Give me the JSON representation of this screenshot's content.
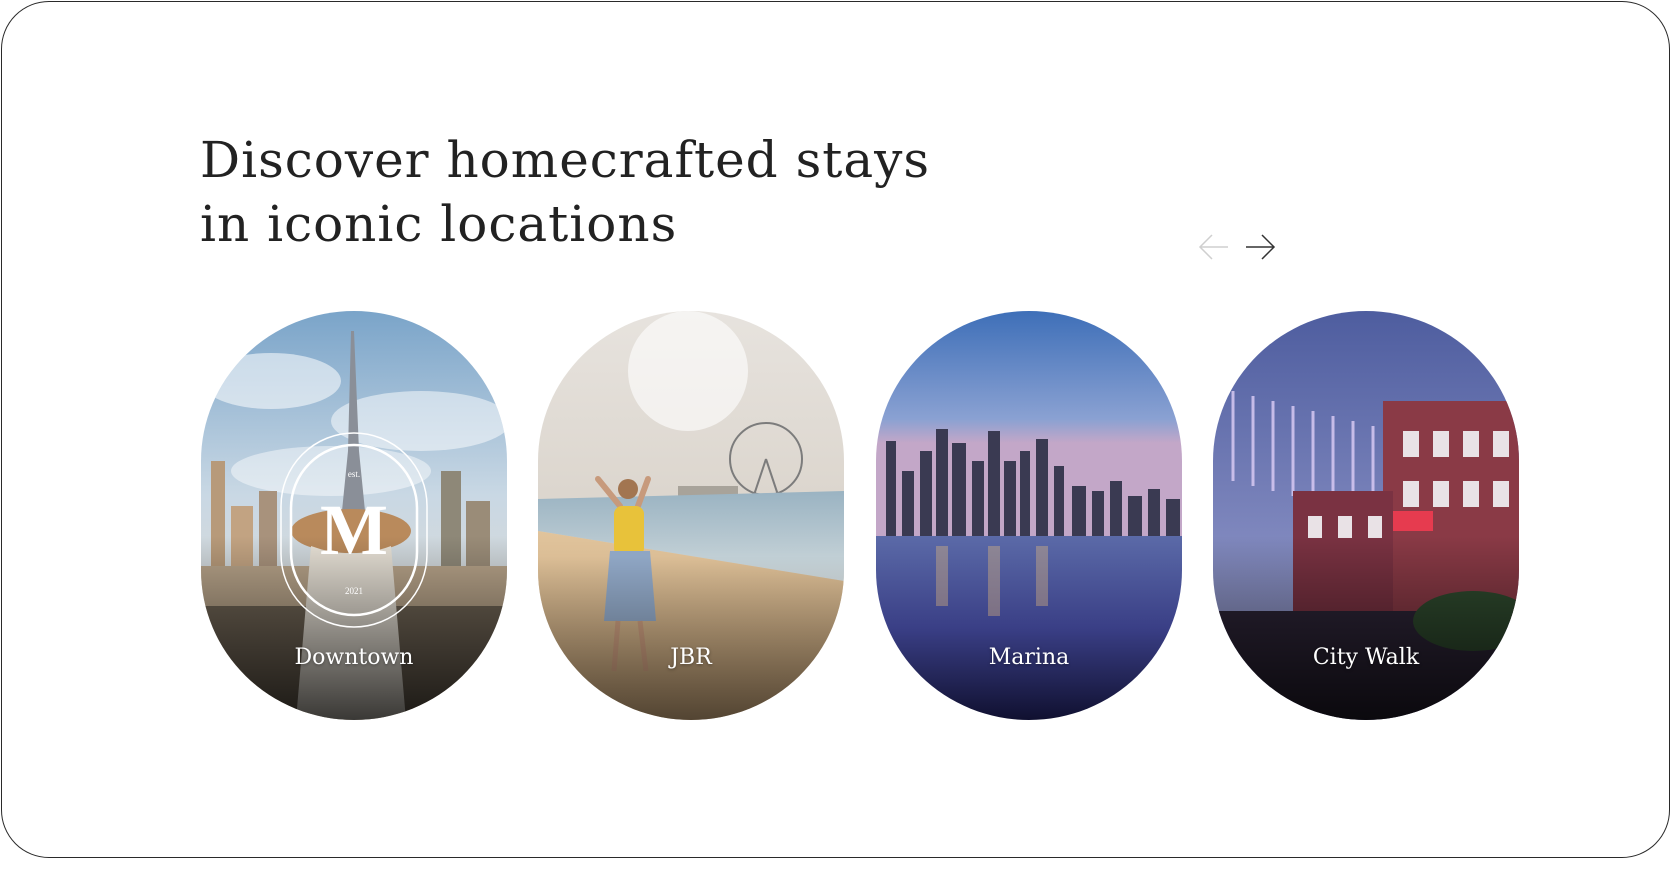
{
  "headline": {
    "line1": "Discover homecrafted stays",
    "line2": "in iconic locations"
  },
  "nav": {
    "prev_icon": "arrow-left-icon",
    "next_icon": "arrow-right-icon"
  },
  "badge": {
    "top_text": "est.",
    "letter": "M",
    "year_text": "2021"
  },
  "locations": [
    {
      "label": "Downtown"
    },
    {
      "label": "JBR"
    },
    {
      "label": "Marina"
    },
    {
      "label": "City Walk"
    }
  ],
  "colors": {
    "headline": "#222222",
    "label": "#ffffff",
    "frame_border": "#2a2a2a"
  }
}
